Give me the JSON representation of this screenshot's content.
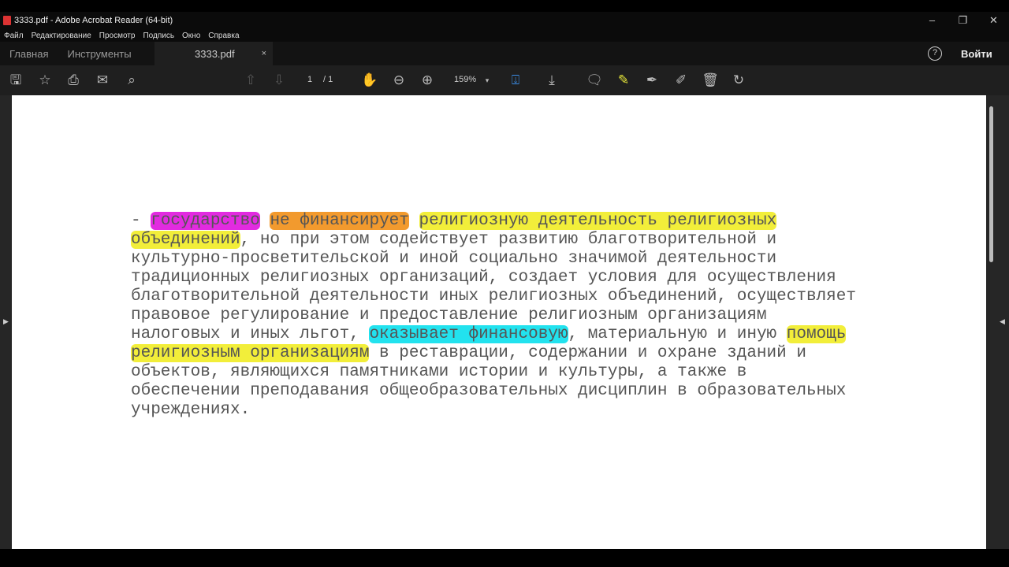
{
  "window": {
    "title": "3333.pdf - Adobe Acrobat Reader (64-bit)"
  },
  "menu": [
    "Файл",
    "Редактирование",
    "Просмотр",
    "Подпись",
    "Окно",
    "Справка"
  ],
  "tabs": {
    "home": "Главная",
    "tools": "Инструменты",
    "document": "3333.pdf",
    "close": "×",
    "help": "?",
    "login": "Войти"
  },
  "toolbar": {
    "page_current": "1",
    "page_total": "/ 1",
    "zoom": "159%"
  },
  "colors": {
    "magenta": "#e22be0",
    "orange": "#f29a2e",
    "yellow": "#f2ee3a",
    "cyan": "#22e2ee"
  },
  "document": {
    "lines": [
      [
        {
          "t": "- "
        },
        {
          "t": "государство",
          "h": "magenta"
        },
        {
          "t": " "
        },
        {
          "t": "не финансирует",
          "h": "orange"
        },
        {
          "t": " "
        },
        {
          "t": "религиозную деятельность религиозных",
          "h": "yellow"
        }
      ],
      [
        {
          "t": "объединений",
          "h": "yellow"
        },
        {
          "t": ", но при этом содействует развитию благотворительной и"
        }
      ],
      [
        {
          "t": "культурно-просветительской и иной социально значимой деятельности"
        }
      ],
      [
        {
          "t": "традиционных религиозных организаций, создает условия для осуществления"
        }
      ],
      [
        {
          "t": "благотворительной деятельности иных религиозных объединений, осуществляет"
        }
      ],
      [
        {
          "t": "правовое регулирование и предоставление религиозным организациям"
        }
      ],
      [
        {
          "t": "налоговых и иных льгот, "
        },
        {
          "t": "оказывает финансовую",
          "h": "cyan"
        },
        {
          "t": ", материальную и иную "
        },
        {
          "t": "помощь",
          "h": "yellow"
        }
      ],
      [
        {
          "t": "религиозным организациям",
          "h": "yellow"
        },
        {
          "t": " в реставрации, содержании и охране зданий и"
        }
      ],
      [
        {
          "t": "объектов, являющихся памятниками истории и культуры, а также в"
        }
      ],
      [
        {
          "t": "обеспечении преподавания общеобразовательных дисциплин в образовательных"
        }
      ],
      [
        {
          "t": "учреждениях."
        }
      ]
    ]
  }
}
